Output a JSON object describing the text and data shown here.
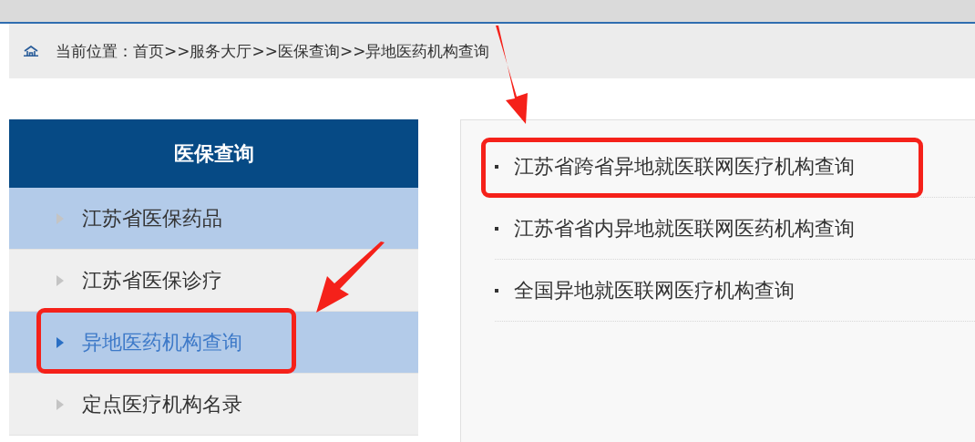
{
  "breadcrumb": {
    "label": "当前位置：",
    "trail": "首页>>服务大厅>>医保查询>>异地医药机构查询"
  },
  "sidebar": {
    "title": "医保查询",
    "items": [
      {
        "label": "江苏省医保药品",
        "highlighted": true,
        "selected": false,
        "annotated": false
      },
      {
        "label": "江苏省医保诊疗",
        "highlighted": false,
        "selected": false,
        "annotated": false
      },
      {
        "label": "异地医药机构查询",
        "highlighted": true,
        "selected": true,
        "annotated": true
      },
      {
        "label": "定点医疗机构名录",
        "highlighted": false,
        "selected": false,
        "annotated": false
      }
    ]
  },
  "links": [
    {
      "label": "江苏省跨省异地就医联网医疗机构查询",
      "annotated": true
    },
    {
      "label": "江苏省省内异地就医联网医药机构查询",
      "annotated": false
    },
    {
      "label": "全国异地就医联网医疗机构查询",
      "annotated": false
    }
  ]
}
